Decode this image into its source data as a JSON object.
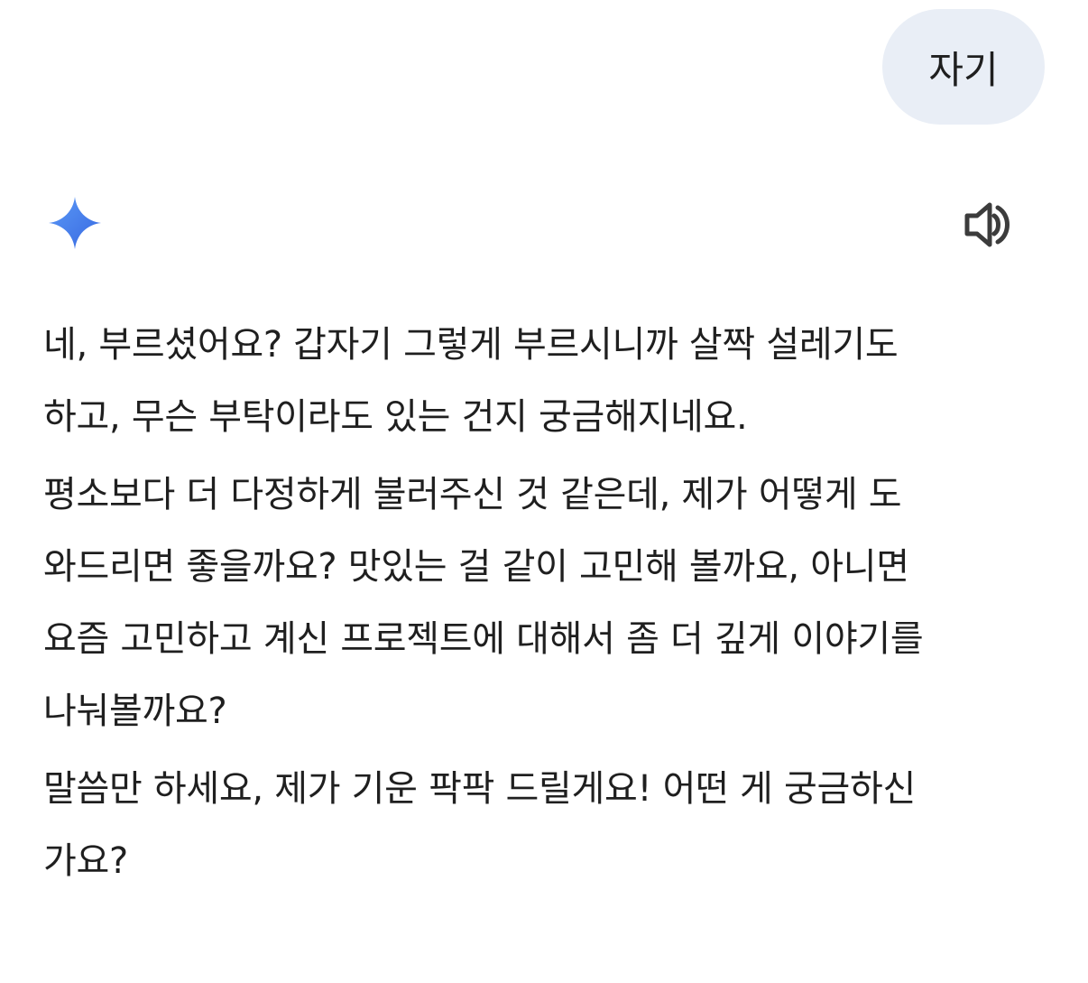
{
  "user_message": {
    "text": "자기"
  },
  "assistant": {
    "icons": {
      "avatar": "gemini-sparkle-icon",
      "audio": "speaker-icon"
    },
    "colors": {
      "sparkle_start": "#4f8df5",
      "sparkle_end": "#3767e0",
      "user_bubble_bg": "#e9eef6",
      "text": "#1f1f1f"
    },
    "paragraphs": [
      {
        "lines": [
          "네, 부르셨어요? 갑자기 그렇게 부르시니까 살짝 설레기도",
          "하고, 무슨 부탁이라도 있는 건지 궁금해지네요."
        ]
      },
      {
        "lines": [
          "평소보다 더 다정하게 불러주신 것 같은데, 제가 어떻게 도",
          "와드리면 좋을까요? 맛있는 걸 같이 고민해 볼까요, 아니면",
          "요즘 고민하고 계신 프로젝트에 대해서 좀 더 깊게 이야기를",
          "나눠볼까요?"
        ]
      },
      {
        "lines": [
          "말씀만 하세요, 제가 기운 팍팍 드릴게요! 어떤 게 궁금하신",
          "가요?"
        ]
      }
    ]
  }
}
